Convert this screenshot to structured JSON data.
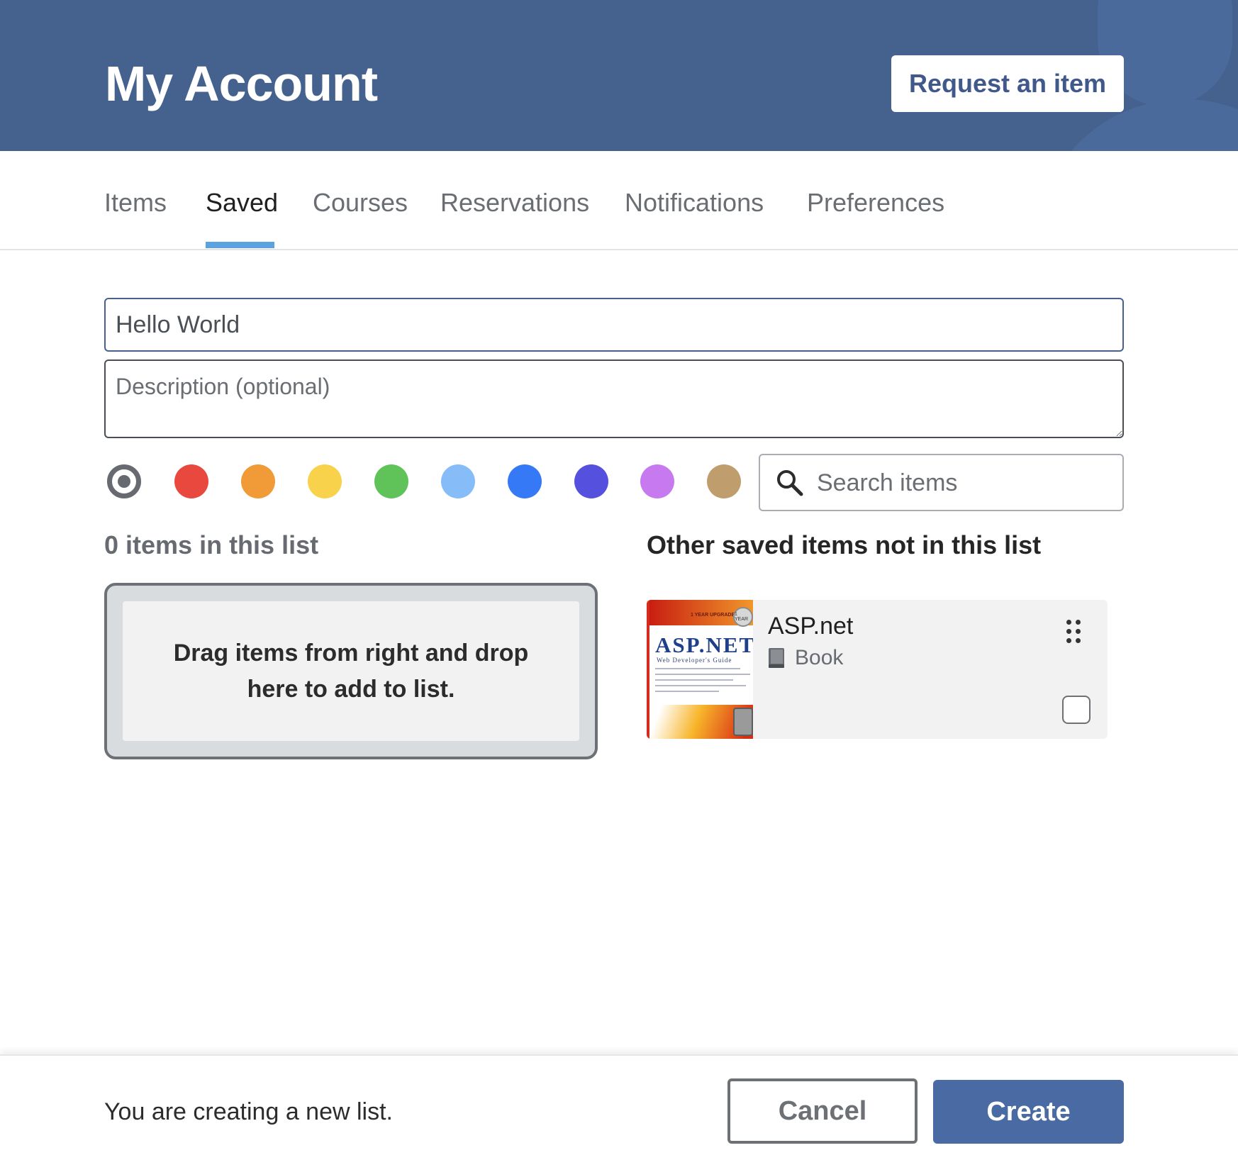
{
  "header": {
    "title": "My Account",
    "request_button": "Request an item",
    "background_color": "#45628f"
  },
  "tabs": [
    {
      "label": "Items",
      "active": false
    },
    {
      "label": "Saved",
      "active": true
    },
    {
      "label": "Courses",
      "active": false
    },
    {
      "label": "Reservations",
      "active": false
    },
    {
      "label": "Notifications",
      "active": false
    },
    {
      "label": "Preferences",
      "active": false
    }
  ],
  "form": {
    "title_value": "Hello World",
    "description_placeholder": "Description (optional)",
    "colors": [
      {
        "name": "none",
        "hex": "#ffffff",
        "selected": true
      },
      {
        "name": "red",
        "hex": "#e8483d",
        "selected": false
      },
      {
        "name": "orange",
        "hex": "#f09a38",
        "selected": false
      },
      {
        "name": "yellow",
        "hex": "#f7d24a",
        "selected": false
      },
      {
        "name": "green",
        "hex": "#5fc35a",
        "selected": false
      },
      {
        "name": "light-blue",
        "hex": "#86bdf8",
        "selected": false
      },
      {
        "name": "blue",
        "hex": "#3579f6",
        "selected": false
      },
      {
        "name": "indigo",
        "hex": "#5650de",
        "selected": false
      },
      {
        "name": "violet",
        "hex": "#c77af0",
        "selected": false
      },
      {
        "name": "tan",
        "hex": "#c09d6c",
        "selected": false
      }
    ],
    "search_placeholder": "Search items",
    "search_icon": "search-icon"
  },
  "list": {
    "count_label": "0 items in this list",
    "drop_text": "Drag items from right and drop here to add to list."
  },
  "other": {
    "title": "Other saved items not in this list",
    "items": [
      {
        "title": "ASP.net",
        "type": "Book",
        "type_icon": "book-icon",
        "checked": false,
        "cover": {
          "title": "ASP.NET",
          "subtitle": "Web Developer's Guide",
          "banner": "1 YEAR UPGRADE",
          "seal": "1 YEAR"
        }
      }
    ]
  },
  "footer": {
    "message": "You are creating a new list.",
    "cancel_label": "Cancel",
    "create_label": "Create",
    "create_color": "#4a6aa3"
  }
}
